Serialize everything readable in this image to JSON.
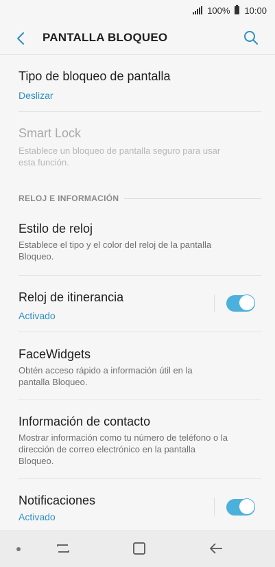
{
  "status": {
    "battery": "100%",
    "time": "10:00"
  },
  "header": {
    "title": "PANTALLA BLOQUEO"
  },
  "items": {
    "tipo": {
      "title": "Tipo de bloqueo de pantalla",
      "sub": "Deslizar"
    },
    "smartlock": {
      "title": "Smart Lock",
      "sub": "Establece un bloqueo de pantalla seguro para usar esta función."
    },
    "section": "RELOJ E INFORMACIÓN",
    "estilo": {
      "title": "Estilo de reloj",
      "sub": "Establece el tipo y el color del reloj de la pantalla Bloqueo."
    },
    "itinerancia": {
      "title": "Reloj de itinerancia",
      "sub": "Activado",
      "toggle_on": true
    },
    "facewidgets": {
      "title": "FaceWidgets",
      "sub": "Obtén acceso rápido a información útil en la pantalla Bloqueo."
    },
    "contacto": {
      "title": "Información de contacto",
      "sub": "Mostrar información como tu número de teléfono o la dirección de correo electrónico en la pantalla Bloqueo."
    },
    "notificaciones": {
      "title": "Notificaciones",
      "sub": "Activado",
      "toggle_on": true
    }
  },
  "colors": {
    "accent": "#2f8fc3",
    "toggle": "#4cb0dc"
  },
  "icons": [
    "signal-icon",
    "battery-icon",
    "back-arrow-icon",
    "search-icon",
    "recents-icon",
    "home-icon",
    "back-nav-icon"
  ]
}
